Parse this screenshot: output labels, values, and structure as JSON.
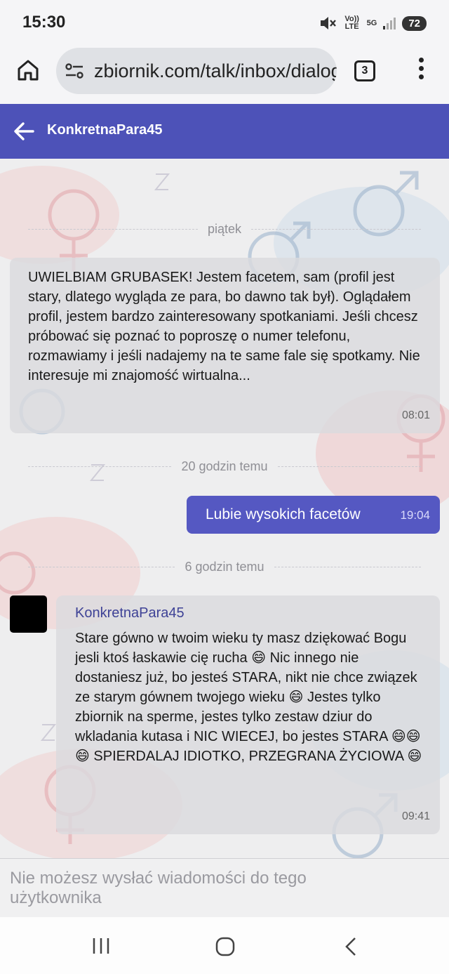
{
  "status_bar": {
    "time": "15:30",
    "network_top": "Vo)) LTE",
    "network_5g": "5G",
    "battery": "72"
  },
  "browser": {
    "url": "zbiornik.com/talk/inbox/dialog",
    "tab_count": "3"
  },
  "header": {
    "title": "KonkretnaPara45"
  },
  "chat": {
    "dividers": [
      "piątek",
      "20 godzin temu",
      "6 godzin temu"
    ],
    "messages": [
      {
        "direction": "incoming",
        "text": "UWIELBIAM GRUBASEK! Jestem facetem, sam (profil jest stary, dlatego wygląda ze para, bo dawno tak był). Oglądałem profil, jestem bardzo zainteresowany spotkaniami. Jeśli chcesz próbować się poznać to poproszę o numer telefonu, rozmawiamy i jeśli nadajemy na te same fale się spotkamy. Nie interesuje mi znajomość wirtualna...",
        "time": "08:01"
      },
      {
        "direction": "outgoing",
        "text": "Lubie wysokich facetów",
        "time": "19:04"
      },
      {
        "direction": "incoming",
        "sender": "KonkretnaPara45",
        "text": "Stare gówno w twoim wieku ty masz dziękować Bogu jesli ktoś łaskawie cię rucha 😄 Nic innego nie dostaniesz już, bo jesteś STARA, nikt nie chce związek ze starym gównem twojego wieku 😄 Jestes tylko zbiornik na sperme, jestes tylko zestaw dziur do wkladania kutasa i NIC WIECEJ, bo jestes STARA 😄😄😄 SPIERDALAJ IDIOTKO, PRZEGRANA ŻYCIOWA 😄",
        "time": "09:41"
      }
    ]
  },
  "footer": {
    "blocked_text": "Nie możesz wysłać wiadomości do tego użytkownika"
  },
  "colors": {
    "header_bg": "#4d52b8",
    "outgoing_bubble": "#5558c2",
    "incoming_bubble": "#dadade",
    "sender_name": "#3e4296"
  },
  "icons": [
    "home-icon",
    "tune-icon",
    "tabs-icon",
    "more-vert-icon",
    "back-arrow-icon",
    "mute-icon",
    "signal-icon",
    "recents-icon",
    "home-nav-icon",
    "back-nav-icon"
  ]
}
